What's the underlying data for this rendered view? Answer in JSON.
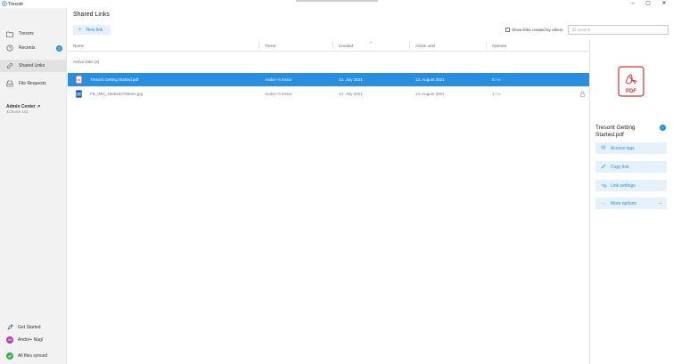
{
  "app": {
    "title": "Tresorit"
  },
  "window": {
    "minimize": "–",
    "maximize": "▢",
    "close": "✕"
  },
  "sidebar": {
    "items": [
      {
        "label": "Tresors",
        "icon": "folder-icon"
      },
      {
        "label": "Recents",
        "icon": "clock-icon",
        "badge": "2"
      },
      {
        "label": "Shared Links",
        "icon": "link-icon",
        "active": true
      },
      {
        "label": "File Requests",
        "icon": "inbox-icon"
      }
    ],
    "admin": {
      "label": "Admin Center ↗",
      "subtitle": "4Choice Ltd."
    },
    "footer": {
      "get_started": "Get Started",
      "user_initials": "AN",
      "user_name": "Andor+ Nagl",
      "sync_status": "All files synced"
    }
  },
  "main": {
    "title": "Shared Links",
    "new_link": {
      "plus": "+",
      "label": "New link"
    },
    "show_others_label": "Show links created by others",
    "search_placeholder": "Search",
    "columns": {
      "name": "Name",
      "tresor": "Tresor",
      "created": "Created",
      "active_until": "Active until",
      "opened": "Opened"
    },
    "section_label": "Active links (2)",
    "rows": [
      {
        "name": "Tresorit Getting Started.pdf",
        "tresor": "Andor+'s tresor",
        "created": "14. July 2021",
        "active_until": "13. August 2021",
        "opened": "0 / ∞",
        "type": "pdf",
        "selected": true
      },
      {
        "name": "FB_IMG_1558163786504.jpg",
        "tresor": "Andor+'s tresor",
        "created": "14. July 2021",
        "active_until": "14. August 2021",
        "opened": "1 / ∞",
        "type": "image",
        "locked": true
      }
    ]
  },
  "detail": {
    "file_label": "PDF",
    "file_name": "Tresorit Getting Started.pdf",
    "actions": [
      {
        "label": "Access logs",
        "icon": "list-icon"
      },
      {
        "label": "Copy link",
        "icon": "link-icon"
      },
      {
        "label": "Link settings",
        "icon": "settings-link-icon"
      },
      {
        "label": "More options",
        "icon": "more-icon"
      }
    ],
    "more_icon": "···",
    "chevron": "⌄"
  },
  "colors": {
    "accent": "#2a8ee0",
    "pdf_red": "#d32f2f",
    "sidebar_bg": "#f2f2f2"
  }
}
